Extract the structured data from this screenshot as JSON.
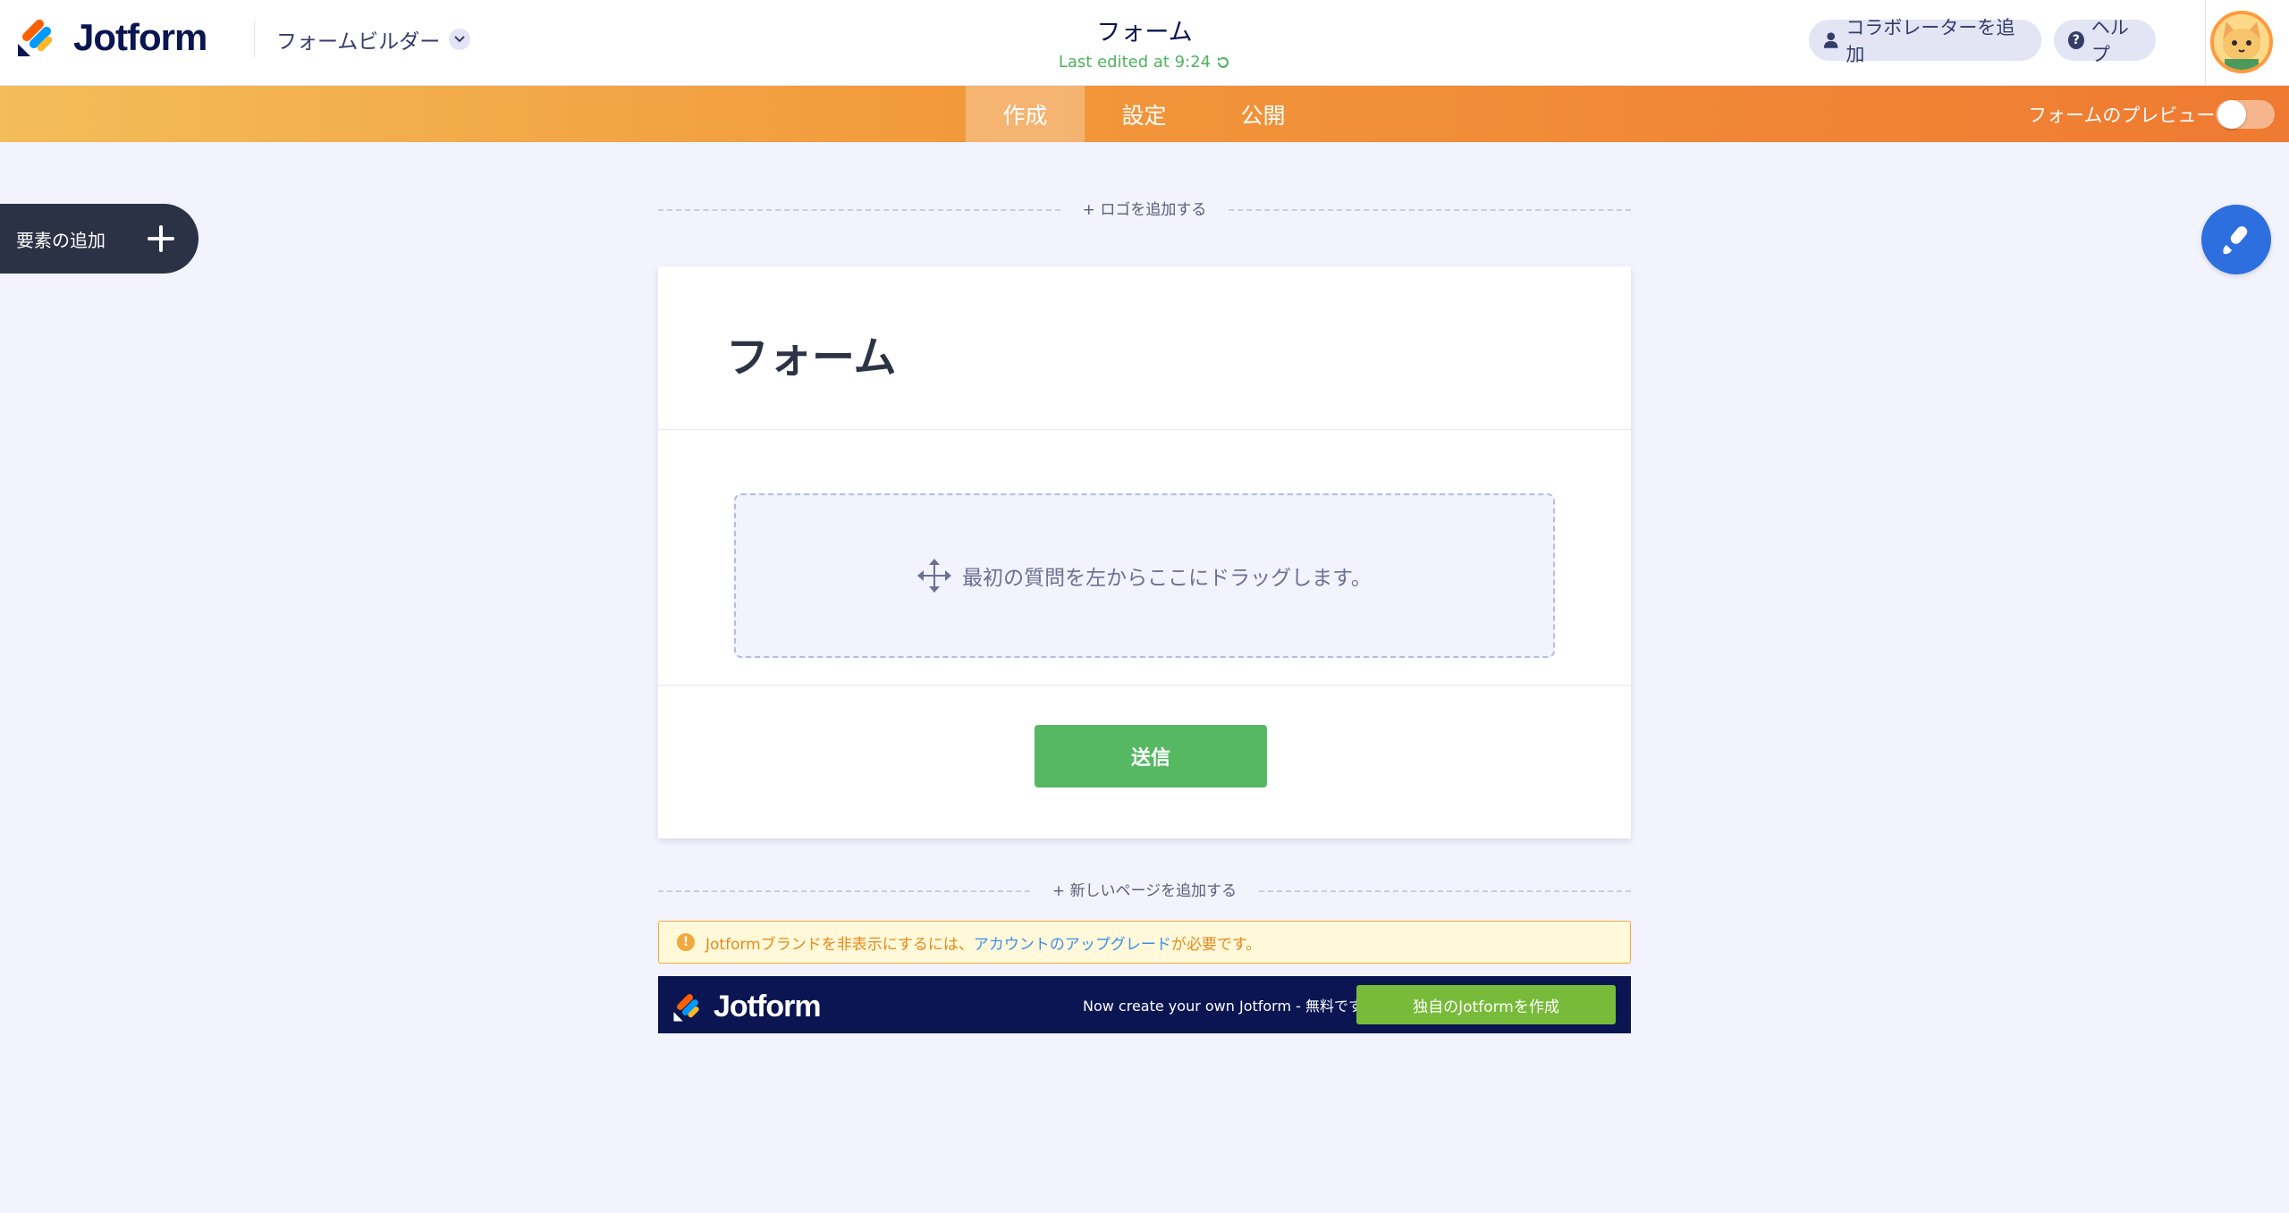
{
  "header": {
    "brand": "Jotform",
    "builder_menu": "フォームビルダー",
    "form_title": "フォーム",
    "last_edited": "Last edited at 9:24",
    "collaborator_button": "コラボレーターを追加",
    "help_button": "ヘルプ"
  },
  "tabs": [
    {
      "label": "作成",
      "active": true
    },
    {
      "label": "設定",
      "active": false
    },
    {
      "label": "公開",
      "active": false
    }
  ],
  "preview": {
    "label": "フォームのプレビュー",
    "enabled": false
  },
  "sidebar": {
    "add_element_label": "要素の追加"
  },
  "form": {
    "add_logo": "+ ロゴを追加する",
    "title": "フォーム",
    "dropzone_text": "最初の質問を左からここにドラッグします。",
    "submit_label": "送信",
    "add_page": "+ 新しいページを追加する"
  },
  "warning": {
    "prefix": "Jotformブランドを非表示にするには、",
    "link": "アカウントのアップグレード",
    "suffix": "が必要です。"
  },
  "footer": {
    "brand": "Jotform",
    "cta_text": "Now create your own Jotform - 無料です",
    "cta_button": "独自のJotformを作成"
  },
  "colors": {
    "accent_orange": "#ef7a31",
    "brand_navy": "#0a1551",
    "submit_green": "#56b863",
    "designer_blue": "#2e6fe0",
    "edited_green": "#4fb15f"
  },
  "icons": {
    "collaborator": "user-icon",
    "help": "question-circle-icon",
    "dropzone": "move-arrows-icon",
    "designer": "paint-brush-icon",
    "warning": "exclamation-circle-icon"
  }
}
